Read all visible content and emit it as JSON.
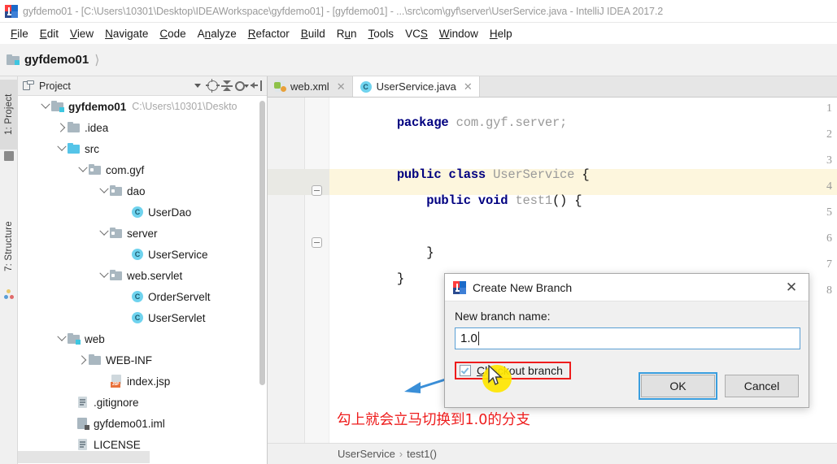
{
  "window": {
    "title": "gyfdemo01 - [C:\\Users\\10301\\Desktop\\IDEAWorkspace\\gyfdemo01] - [gyfdemo01] - ...\\src\\com\\gyf\\server\\UserService.java - IntelliJ IDEA 2017.2",
    "icon": "intellij-idea-icon"
  },
  "menubar": {
    "items": [
      {
        "label": "File",
        "mnemonic": "F"
      },
      {
        "label": "Edit",
        "mnemonic": "E"
      },
      {
        "label": "View",
        "mnemonic": "V"
      },
      {
        "label": "Navigate",
        "mnemonic": "N"
      },
      {
        "label": "Code",
        "mnemonic": "C"
      },
      {
        "label": "Analyze",
        "mnemonic": "A"
      },
      {
        "label": "Refactor",
        "mnemonic": "R"
      },
      {
        "label": "Build",
        "mnemonic": "B"
      },
      {
        "label": "Run",
        "mnemonic": "u"
      },
      {
        "label": "Tools",
        "mnemonic": "T"
      },
      {
        "label": "VCS",
        "mnemonic": "S"
      },
      {
        "label": "Window",
        "mnemonic": "W"
      },
      {
        "label": "Help",
        "mnemonic": "H"
      }
    ]
  },
  "navbar": {
    "crumb": "gyfdemo01"
  },
  "tool_tabs": {
    "project": "1: Project",
    "structure": "7: Structure"
  },
  "project_panel": {
    "header_title": "Project",
    "buttons": [
      {
        "name": "view-mode-dropdown",
        "icon": "chevron-down-icon"
      },
      {
        "name": "scroll-from-source",
        "icon": "target-icon"
      },
      {
        "name": "collapse-all",
        "icon": "collapse-all-icon"
      },
      {
        "name": "settings",
        "icon": "gear-icon"
      },
      {
        "name": "hide-panel",
        "icon": "hide-panel-icon"
      }
    ],
    "tree": [
      {
        "label": "gyfdemo01",
        "path": "C:\\Users\\10301\\Deskto",
        "indent": 0,
        "arrow": "open",
        "icon": "project-folder-icon",
        "bold": true
      },
      {
        "label": ".idea",
        "path": "",
        "indent": 1,
        "arrow": "closed",
        "icon": "folder-icon",
        "bold": false
      },
      {
        "label": "src",
        "path": "",
        "indent": 1,
        "arrow": "open",
        "icon": "source-folder-icon",
        "bold": false
      },
      {
        "label": "com.gyf",
        "path": "",
        "indent": 2,
        "arrow": "open",
        "icon": "package-icon",
        "bold": false
      },
      {
        "label": "dao",
        "path": "",
        "indent": 3,
        "arrow": "open",
        "icon": "package-icon",
        "bold": false
      },
      {
        "label": "UserDao",
        "path": "",
        "indent": 4,
        "arrow": "none",
        "icon": "java-class-icon",
        "bold": false
      },
      {
        "label": "server",
        "path": "",
        "indent": 3,
        "arrow": "open",
        "icon": "package-icon",
        "bold": false
      },
      {
        "label": "UserService",
        "path": "",
        "indent": 4,
        "arrow": "none",
        "icon": "java-class-icon",
        "bold": false
      },
      {
        "label": "web.servlet",
        "path": "",
        "indent": 3,
        "arrow": "open",
        "icon": "package-icon",
        "bold": false
      },
      {
        "label": "OrderServelt",
        "path": "",
        "indent": 4,
        "arrow": "none",
        "icon": "java-class-icon",
        "bold": false
      },
      {
        "label": "UserServlet",
        "path": "",
        "indent": 4,
        "arrow": "none",
        "icon": "java-class-icon",
        "bold": false
      },
      {
        "label": "web",
        "path": "",
        "indent": 1,
        "arrow": "open",
        "icon": "web-folder-icon",
        "bold": false
      },
      {
        "label": "WEB-INF",
        "path": "",
        "indent": 2,
        "arrow": "closed",
        "icon": "folder-icon",
        "bold": false
      },
      {
        "label": "index.jsp",
        "path": "",
        "indent": 2,
        "arrow": "none",
        "icon": "jsp-file-icon",
        "bold": false
      },
      {
        "label": ".gitignore",
        "path": "",
        "indent": 1,
        "arrow": "none",
        "icon": "text-file-icon",
        "bold": false
      },
      {
        "label": "gyfdemo01.iml",
        "path": "",
        "indent": 1,
        "arrow": "none",
        "icon": "iml-file-icon",
        "bold": false
      },
      {
        "label": "LICENSE",
        "path": "",
        "indent": 1,
        "arrow": "none",
        "icon": "text-file-icon",
        "bold": false
      }
    ]
  },
  "editor": {
    "tabs": [
      {
        "label": "web.xml",
        "icon": "xml-file-icon",
        "active": false
      },
      {
        "label": "UserService.java",
        "icon": "java-class-icon",
        "active": true
      }
    ],
    "line_numbers": [
      "1",
      "2",
      "3",
      "4",
      "5",
      "6",
      "7",
      "8"
    ],
    "caret_line": 5,
    "code": [
      {
        "line": 1,
        "tokens": [
          {
            "t": "package",
            "c": "kw"
          },
          {
            "t": " com.gyf.server;",
            "c": "id"
          }
        ]
      },
      {
        "line": 2,
        "tokens": []
      },
      {
        "line": 3,
        "tokens": [
          {
            "t": "public class ",
            "c": "kw"
          },
          {
            "t": "UserService",
            "c": "id"
          },
          {
            "t": " {",
            "c": "pn"
          }
        ]
      },
      {
        "line": 4,
        "tokens": [
          {
            "t": "    public void ",
            "c": "kw"
          },
          {
            "t": "test1",
            "c": "id"
          },
          {
            "t": "() {",
            "c": "pn"
          }
        ]
      },
      {
        "line": 5,
        "tokens": []
      },
      {
        "line": 6,
        "tokens": [
          {
            "t": "    }",
            "c": "pn"
          }
        ]
      },
      {
        "line": 7,
        "tokens": [
          {
            "t": "}",
            "c": "pn"
          }
        ]
      },
      {
        "line": 8,
        "tokens": []
      }
    ]
  },
  "breadcrumb": {
    "parts": [
      "UserService",
      "test1()"
    ],
    "separator": "›"
  },
  "dialog": {
    "title": "Create New Branch",
    "icon": "intellij-idea-icon",
    "close_label": "✕",
    "field_label": "New branch name:",
    "field_value": "1.0",
    "field_placeholder": "",
    "checkbox_label": "Checkout branch",
    "checkbox_mnemonic": "C",
    "checkbox_checked": true,
    "ok_label": "OK",
    "cancel_label": "Cancel"
  },
  "annotation": {
    "text": "勾上就会立马切换到1.0的分支",
    "color": "#ee1c1c",
    "arrow_color": "#3a8fd8",
    "highlight_box_color": "#ee1c1c",
    "cursor_highlight_color": "#ffe600"
  },
  "colors": {
    "accent_blue": "#3a9ede",
    "keyword_navy": "#000080",
    "identifier_gray": "#9a9a9a",
    "caret_line_yellow": "#fdf6dd",
    "panel_gray": "#f0f0f0",
    "java_class_cyan": "#6fd3ee"
  }
}
